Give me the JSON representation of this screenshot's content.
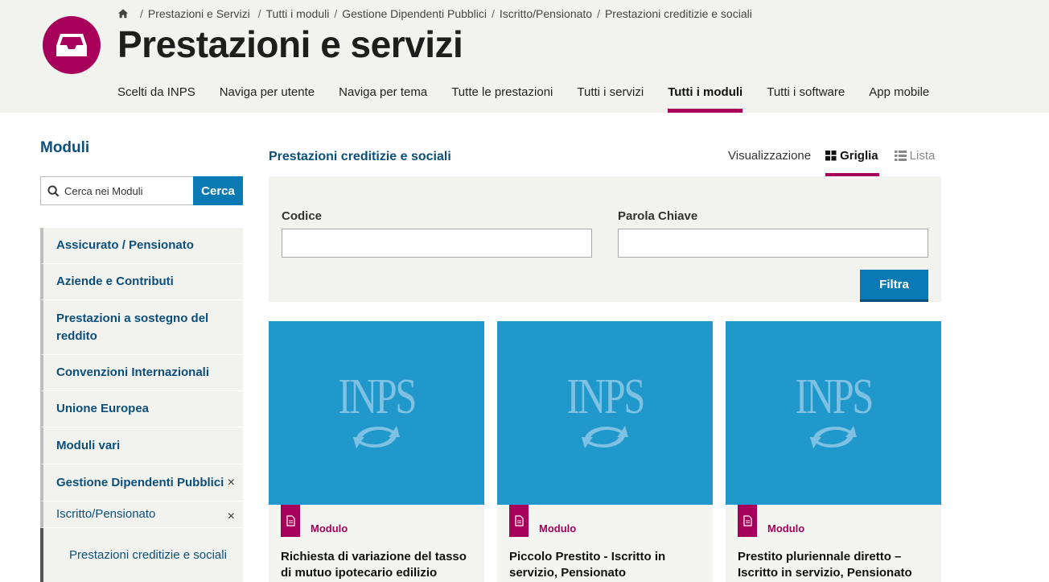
{
  "header": {
    "breadcrumb": [
      "Prestazioni e Servizi",
      "Tutti i moduli",
      "Gestione Dipendenti Pubblici",
      "Iscritto/Pensionato",
      "Prestazioni creditizie e sociali"
    ],
    "title": "Prestazioni e servizi",
    "nav": [
      {
        "label": "Scelti da INPS"
      },
      {
        "label": "Naviga per utente"
      },
      {
        "label": "Naviga per tema"
      },
      {
        "label": "Tutte le prestazioni"
      },
      {
        "label": "Tutti i servizi"
      },
      {
        "label": "Tutti i moduli",
        "active": true
      },
      {
        "label": "Tutti i software"
      },
      {
        "label": "App mobile"
      }
    ]
  },
  "sidebar": {
    "title": "Moduli",
    "search": {
      "placeholder": "Cerca nei Moduli",
      "button": "Cerca"
    },
    "items": [
      {
        "label": "Assicurato / Pensionato"
      },
      {
        "label": "Aziende e Contributi"
      },
      {
        "label": "Prestazioni a sostegno del reddito"
      },
      {
        "label": "Convenzioni Internazionali"
      },
      {
        "label": "Unione Europea"
      },
      {
        "label": "Moduli vari"
      },
      {
        "label": "Gestione Dipendenti Pubblici",
        "close": "×"
      },
      {
        "label": "Iscritto/Pensionato",
        "close": "×"
      },
      {
        "label": "Prestazioni creditizie e sociali"
      }
    ]
  },
  "main": {
    "heading": "Prestazioni creditizie e sociali",
    "view": {
      "label": "Visualizzazione",
      "grid": "Griglia",
      "list": "Lista"
    },
    "filter": {
      "code_label": "Codice",
      "keyword_label": "Parola Chiave",
      "button": "Filtra"
    },
    "cards": [
      {
        "logo": "INPS",
        "type": "Modulo",
        "title": "Richiesta di variazione del tasso di mutuo ipotecario edilizio"
      },
      {
        "logo": "INPS",
        "type": "Modulo",
        "title": "Piccolo Prestito - Iscritto in servizio, Pensionato"
      },
      {
        "logo": "INPS",
        "type": "Modulo",
        "title": "Prestito pluriennale diretto – Iscritto in servizio, Pensionato"
      }
    ]
  },
  "colors": {
    "brand": "#a6005b",
    "primary_blue": "#0a7ab4",
    "card_blue": "#2198cb",
    "heading_blue": "#0b4f7a"
  }
}
